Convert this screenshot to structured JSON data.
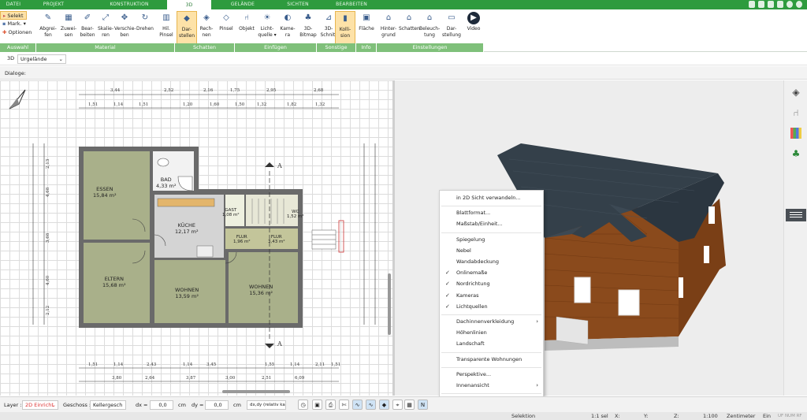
{
  "tabs": [
    "DATEI",
    "PROJEKT",
    "KONSTRUKTION",
    "3D",
    "GELÄNDE",
    "SICHTEN",
    "BEARBEITEN"
  ],
  "ribbon": {
    "select_tools": [
      "Selekt",
      "Mark.",
      "Optionen"
    ],
    "buttons": [
      {
        "label": "Abgrei-\nfen",
        "icon": "pipette-icon",
        "glyph": "✎"
      },
      {
        "label": "Zuwei-\nsen",
        "icon": "assign-icon",
        "glyph": "▦"
      },
      {
        "label": "Bear-\nbeiten",
        "icon": "edit-icon",
        "glyph": "✐"
      },
      {
        "label": "Skalie-\nren",
        "icon": "scale-icon",
        "glyph": "⤢"
      },
      {
        "label": "Verschie-\nben",
        "icon": "move-icon",
        "glyph": "✥"
      },
      {
        "label": "Drehen",
        "icon": "rotate-icon",
        "glyph": "↻"
      },
      {
        "label": "Hil.\nPinsel",
        "icon": "brush-icon",
        "glyph": "▥"
      },
      {
        "label": "Dar-\nstellen",
        "icon": "render-cube-icon",
        "glyph": "◆"
      },
      {
        "label": "Rech-\nnen",
        "icon": "calc-cube-icon",
        "glyph": "◈"
      },
      {
        "label": "Pinsel",
        "icon": "paint-brush-icon",
        "glyph": "◇"
      },
      {
        "label": "Objekt",
        "icon": "chair-icon",
        "glyph": "⑁"
      },
      {
        "label": "Licht-\nquelle ▾",
        "icon": "bulb-icon",
        "glyph": "☀"
      },
      {
        "label": "Kame-\nra",
        "icon": "camera-icon",
        "glyph": "◐"
      },
      {
        "label": "3D-\nBitmap",
        "icon": "tree-icon",
        "glyph": "♣"
      },
      {
        "label": "3D-\nSchnitt",
        "icon": "cut-icon",
        "glyph": "⊿"
      },
      {
        "label": "Kolli-\nsion",
        "icon": "collision-icon",
        "glyph": "▮"
      },
      {
        "label": "Fläche",
        "icon": "area-icon",
        "glyph": "▣"
      },
      {
        "label": "Hinter-\ngrund",
        "icon": "background-house-icon",
        "glyph": "⌂"
      },
      {
        "label": "Schatten",
        "icon": "shadow-house-icon",
        "glyph": "⌂"
      },
      {
        "label": "Beleuch-\ntung",
        "icon": "lighting-house-icon",
        "glyph": "⌂"
      },
      {
        "label": "Dar-\nstellung",
        "icon": "display-icon",
        "glyph": "▭"
      },
      {
        "label": "Video",
        "icon": "play-icon",
        "glyph": "▶"
      }
    ],
    "groups": [
      "Auswahl",
      "Material",
      "Schatten",
      "Einfügen",
      "Sonstige",
      "Info",
      "Einstellungen"
    ]
  },
  "view_selector": {
    "mode": "3D",
    "value": "Urgelände"
  },
  "dialoge_label": "Dialoge:",
  "plan": {
    "rooms": [
      {
        "name": "ESSEN",
        "area": "15,84 m²"
      },
      {
        "name": "BAD",
        "area": "4,33 m²"
      },
      {
        "name": "KÜCHE",
        "area": "12,17 m²"
      },
      {
        "name": "GAST",
        "area": "1,08 m²"
      },
      {
        "name": "WC",
        "area": "1,52 m²"
      },
      {
        "name": "FLUR",
        "area": "1,96 m²"
      },
      {
        "name": "FLUR",
        "area": "3,43 m²"
      },
      {
        "name": "ELTERN",
        "area": "15,68 m²"
      },
      {
        "name": "WOHNEN",
        "area": "13,59 m²"
      },
      {
        "name": "WOHNEN",
        "area": "15,36 m²"
      }
    ],
    "top_dims": [
      "3,44",
      "2,52",
      "2,16",
      "1,75",
      "2,95",
      "2,68"
    ],
    "top_dims2": [
      "1,51",
      "1,14",
      "1,51",
      "1,20",
      "1,60",
      "1,50",
      "1,32",
      "1,82",
      "1,32"
    ],
    "bottom_dims": [
      "1,51",
      "1,14",
      "2,43",
      "1,14",
      "3,45",
      "1,55",
      "1,14",
      "2,11",
      "1,51"
    ],
    "bottom_dims2": [
      "3,80",
      "2,64",
      "3,87",
      "3,00",
      "2,51",
      "6,09"
    ],
    "left_dims": [
      "2,13",
      "4,68",
      "3,68",
      "4,60",
      "2,12"
    ],
    "section_marks": [
      "A",
      "A"
    ]
  },
  "context_menu": [
    {
      "label": "in 2D Sicht verwandeln...",
      "checked": false,
      "submenu": false
    },
    {
      "sep": true
    },
    {
      "label": "Blattformat...",
      "checked": false,
      "submenu": false
    },
    {
      "label": "Maßstab/Einheit...",
      "checked": false,
      "submenu": false
    },
    {
      "sep": true
    },
    {
      "label": "Spiegelung",
      "checked": false,
      "submenu": false
    },
    {
      "label": "Nebel",
      "checked": false,
      "submenu": false
    },
    {
      "label": "Wandabdeckung",
      "checked": false,
      "submenu": false
    },
    {
      "label": "Onlinemaße",
      "checked": true,
      "submenu": false
    },
    {
      "label": "Nordrichtung",
      "checked": true,
      "submenu": false
    },
    {
      "label": "Kameras",
      "checked": true,
      "submenu": false
    },
    {
      "label": "Lichtquellen",
      "checked": true,
      "submenu": false
    },
    {
      "sep": true
    },
    {
      "label": "Dachinnenverkleidung",
      "checked": false,
      "submenu": true
    },
    {
      "label": "Höhenlinien",
      "checked": false,
      "submenu": false
    },
    {
      "label": "Landschaft",
      "checked": false,
      "submenu": false
    },
    {
      "sep": true
    },
    {
      "label": "Transparente Wohnungen",
      "checked": false,
      "submenu": false
    },
    {
      "sep": true
    },
    {
      "label": "Perspektive...",
      "checked": false,
      "submenu": false
    },
    {
      "label": "Innenansicht",
      "checked": false,
      "submenu": true
    },
    {
      "sep": true
    },
    {
      "label": "Zoomen",
      "checked": false,
      "submenu": true
    }
  ],
  "statusbar": {
    "layer_label": "Layer :",
    "layer_value": "2D Einricht",
    "geschoss_label": "Geschoss :",
    "geschoss_value": "Kellergesch",
    "dx_label": "dx =",
    "dx_value": "0,0",
    "dy_label": "dy =",
    "dy_value": "0,0",
    "unit": "cm",
    "mode_value": "dx,dy (relativ ka"
  },
  "infobar": {
    "mode": "Selektion",
    "scale_sel": "1:1 sel",
    "x_label": "X:",
    "y_label": "Y:",
    "z_label": "Z:",
    "scale": "1:100",
    "unit": "Zentimeter",
    "ein": "Ein",
    "flags": "UF NUM RF"
  },
  "colors": {
    "tab_green": "#2e9b3e",
    "group_green": "#7fc07a",
    "active_orange": "#fde2a8",
    "room_fill": "#a9b08a",
    "wall": "#6a6a6a",
    "roof": "#34404a",
    "timber": "#8a4a1c"
  }
}
